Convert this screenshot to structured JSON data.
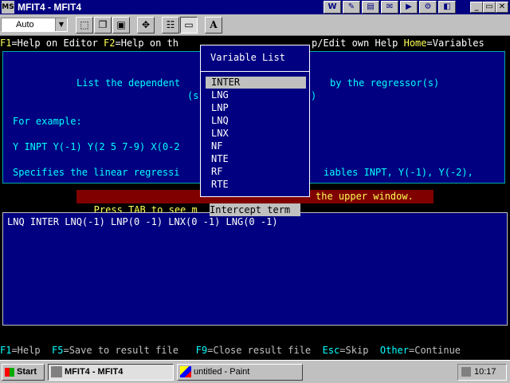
{
  "window": {
    "title": "MFIT4 - MFIT4",
    "app_icon": "MS",
    "title_tools": [
      "W",
      "✎",
      "▤",
      "✉",
      "▶",
      "⚙",
      "◧"
    ],
    "minimize": "_",
    "maximize": "▭",
    "close": "✕"
  },
  "toolbar": {
    "font_select_value": "Auto",
    "buttons": [
      {
        "icon": "mark-icon",
        "glyph": "⬚"
      },
      {
        "icon": "copy-icon",
        "glyph": "❐"
      },
      {
        "icon": "paste-icon",
        "glyph": "▣"
      },
      {
        "icon": "fullscreen-icon",
        "glyph": "✥"
      },
      {
        "icon": "properties-icon",
        "glyph": "☷"
      },
      {
        "icon": "background-icon",
        "glyph": "▭"
      },
      {
        "icon": "font-icon",
        "glyph": "A"
      }
    ]
  },
  "help_bar": {
    "f1_key": "F1",
    "f1_text": "=Help on Editor ",
    "f2_key": "F2",
    "f2_text": "=Help on th",
    "rest_text": "p/Edit own Help ",
    "home_key": "Home",
    "home_text": "=Variables"
  },
  "editor": {
    "line1_left": "List the dependent",
    "line1_right": "by the regressor(s)",
    "line2_left": "(s",
    "line2_right": ")",
    "example_label": "For example:",
    "example_cmd": "Y INPT Y(-1) Y(2 5 7-9) X(0-2",
    "spec_left": "Specifies the linear regressi",
    "spec_right": "iables INPT, Y(-1), Y(-2),"
  },
  "status_bar": {
    "left": " Press TAB to see m",
    "right": "the upper window. "
  },
  "variable_list": {
    "title": "Variable List",
    "items": [
      "INTER",
      "LNG",
      "LNP",
      "LNQ",
      "LNX",
      "NF",
      "NTE",
      "RF",
      "RTE"
    ],
    "selected": "INTER",
    "hint": "Intercept term"
  },
  "result": {
    "text": "LNQ INTER LNQ(-1) LNP(0 -1) LNX(0 -1) LNG(0 -1)"
  },
  "key_bar": {
    "f1_key": "F1",
    "f1_text": "=Help  ",
    "f5_key": "F5",
    "f5_text": "=Save to result file   ",
    "f9_key": "F9",
    "f9_text": "=Close result file  ",
    "esc_key": "Esc",
    "esc_text": "=Skip  ",
    "other_key": "Other",
    "other_text": "=Continue"
  },
  "taskbar": {
    "start_label": "Start",
    "tasks": [
      "MFIT4 - MFIT4",
      "untitled - Paint"
    ],
    "clock": "10:17"
  },
  "colors": {
    "title_bar": "#000080",
    "editor_bg": "#000080",
    "editor_text": "#00ffff",
    "status_bg": "#800000",
    "status_text": "#ffff55",
    "hotkey": "#ffff55"
  }
}
